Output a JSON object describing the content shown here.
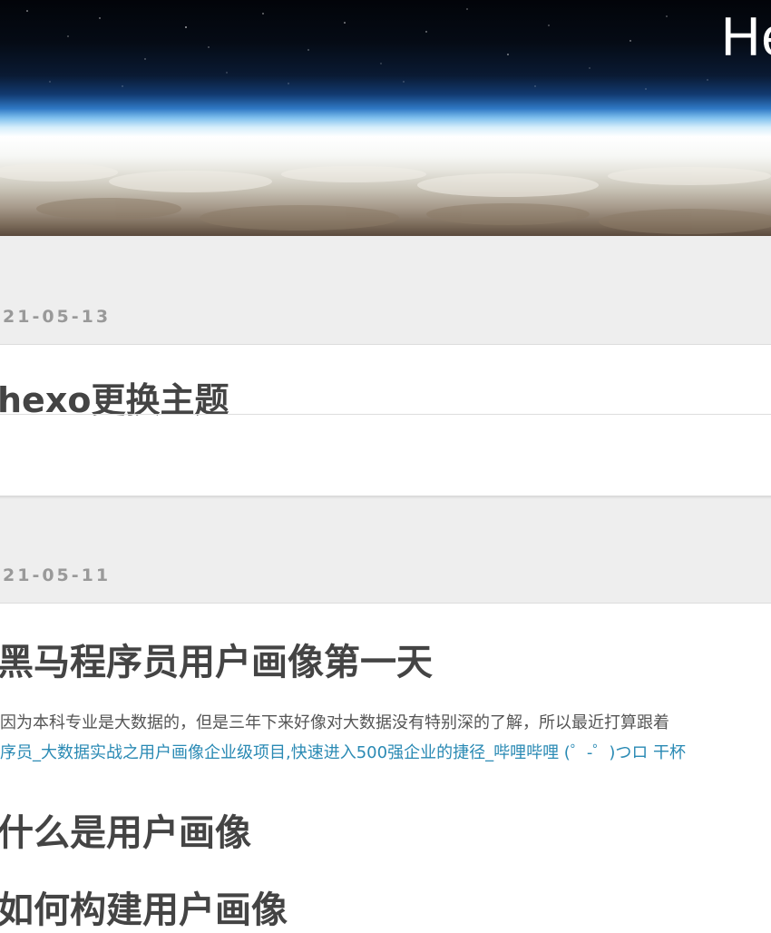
{
  "header": {
    "site_title": "He"
  },
  "posts": [
    {
      "date": "21-05-13",
      "title": "hexo更换主题"
    },
    {
      "date": "21-05-11",
      "title": "黑马程序员用户画像第一天",
      "excerpt": "因为本科专业是大数据的，但是三年下来好像对大数据没有特别深的了解，所以最近打算跟着",
      "link_text": "序员_大数据实战之用户画像企业级项目,快速进入500强企业的捷径_哔哩哔哩 (゜-゜)つロ 干杯",
      "headings": [
        "什么是用户画像",
        "如何构建用户画像"
      ]
    }
  ],
  "colors": {
    "band_bg": "#eeeeee",
    "date_text": "#999999",
    "title_text": "#444444",
    "link": "#2a8ab4"
  }
}
